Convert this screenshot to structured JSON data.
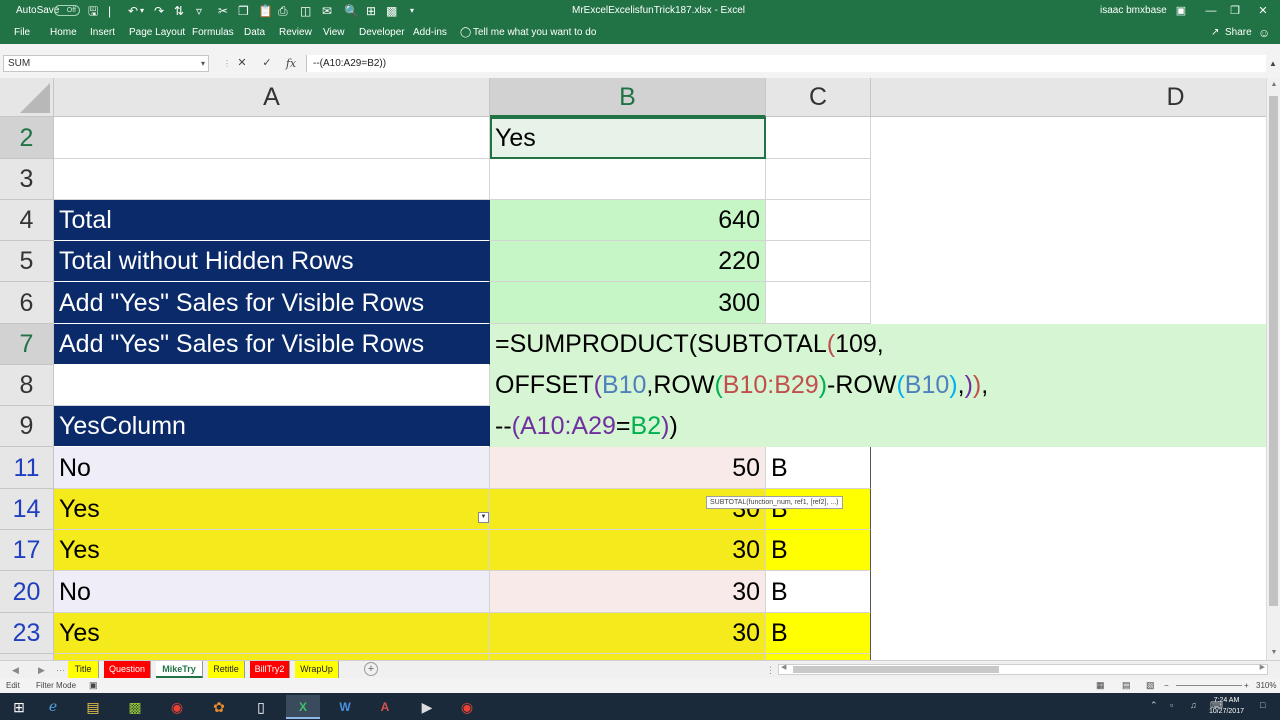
{
  "titlebar": {
    "autosave_label": "AutoSave",
    "autosave_state": "Off",
    "filename": "MrExcelExcelisfunTrick187.xlsx  -  Excel",
    "user": "isaac bmxbase"
  },
  "ribbon": {
    "tabs": [
      "File",
      "Home",
      "Insert",
      "Page Layout",
      "Formulas",
      "Data",
      "Review",
      "View",
      "Developer",
      "Add-ins"
    ],
    "tell_me": "Tell me what you want to do",
    "share": "Share"
  },
  "formula_bar": {
    "name_box": "SUM",
    "formula": "--(A10:A29=B2))"
  },
  "columns": [
    "A",
    "B",
    "C",
    "D"
  ],
  "rows": [
    {
      "num": "2",
      "a": "",
      "b": "Yes",
      "c": ""
    },
    {
      "num": "3",
      "a": "",
      "b": "",
      "c": ""
    },
    {
      "num": "4",
      "a": "Total",
      "b": "640",
      "c": ""
    },
    {
      "num": "5",
      "a": "Total without Hidden Rows",
      "b": "220",
      "c": ""
    },
    {
      "num": "6",
      "a": "Add \"Yes\" Sales for Visible Rows",
      "b": "300",
      "c": ""
    },
    {
      "num": "7",
      "a": "Add \"Yes\" Sales for Visible Rows",
      "b": "",
      "c": ""
    },
    {
      "num": "8",
      "a": "",
      "b": "",
      "c": ""
    },
    {
      "num": "9",
      "a": "YesColumn",
      "b": "",
      "c": ""
    },
    {
      "num": "11",
      "a": "No",
      "b": "50",
      "c": "B"
    },
    {
      "num": "14",
      "a": "Yes",
      "b": "30",
      "c": "B"
    },
    {
      "num": "17",
      "a": "Yes",
      "b": "30",
      "c": "B"
    },
    {
      "num": "20",
      "a": "No",
      "b": "30",
      "c": "B"
    },
    {
      "num": "23",
      "a": "Yes",
      "b": "30",
      "c": "B"
    }
  ],
  "formula_edit": {
    "line1": [
      {
        "t": "=SUMPRODUCT(SUBTOTAL",
        "c": "#000000"
      },
      {
        "t": "(",
        "c": "#c0504d"
      },
      {
        "t": "109,",
        "c": "#000000"
      }
    ],
    "line2": [
      {
        "t": "OFFSET",
        "c": "#000000"
      },
      {
        "t": "(",
        "c": "#7030a0"
      },
      {
        "t": "B10",
        "c": "#4f81bd"
      },
      {
        "t": ",ROW",
        "c": "#000000"
      },
      {
        "t": "(",
        "c": "#00b050"
      },
      {
        "t": "B10:B29",
        "c": "#c0504d"
      },
      {
        "t": ")",
        "c": "#00b050"
      },
      {
        "t": "-ROW",
        "c": "#000000"
      },
      {
        "t": "(",
        "c": "#00b0f0"
      },
      {
        "t": "B10",
        "c": "#4f81bd"
      },
      {
        "t": ")",
        "c": "#00b0f0"
      },
      {
        "t": ",",
        "c": "#000000"
      },
      {
        "t": ")",
        "c": "#7030a0"
      },
      {
        "t": ")",
        "c": "#c0504d"
      },
      {
        "t": ",",
        "c": "#000000"
      }
    ],
    "line3": [
      {
        "t": "--",
        "c": "#000000"
      },
      {
        "t": "(",
        "c": "#7030a0"
      },
      {
        "t": "A10:A29",
        "c": "#7030a0"
      },
      {
        "t": "=",
        "c": "#000000"
      },
      {
        "t": "B2",
        "c": "#00b050"
      },
      {
        "t": ")",
        "c": "#7030a0"
      },
      {
        "t": ")",
        "c": "#000000"
      }
    ],
    "tooltip": "SUBTOTAL(function_num, ref1, [ref2], ...)"
  },
  "sheet_tabs": [
    {
      "label": "Title",
      "color": "#ffff00"
    },
    {
      "label": "Question",
      "color": "#ff0000"
    },
    {
      "label": "MikeTry",
      "color": "#ffffff"
    },
    {
      "label": "Retitle",
      "color": "#ffff00"
    },
    {
      "label": "BillTry2",
      "color": "#ff0000"
    },
    {
      "label": "WrapUp",
      "color": "#ffff00"
    }
  ],
  "status": {
    "mode": "Edit",
    "filter": "Filter Mode",
    "zoom": "310%"
  },
  "taskbar": {
    "time": "7:24 AM",
    "date": "10/27/2017"
  },
  "colors": {
    "excel_green": "#217346",
    "navy": "#0b2a6a",
    "mint": "#c6f6c6"
  }
}
